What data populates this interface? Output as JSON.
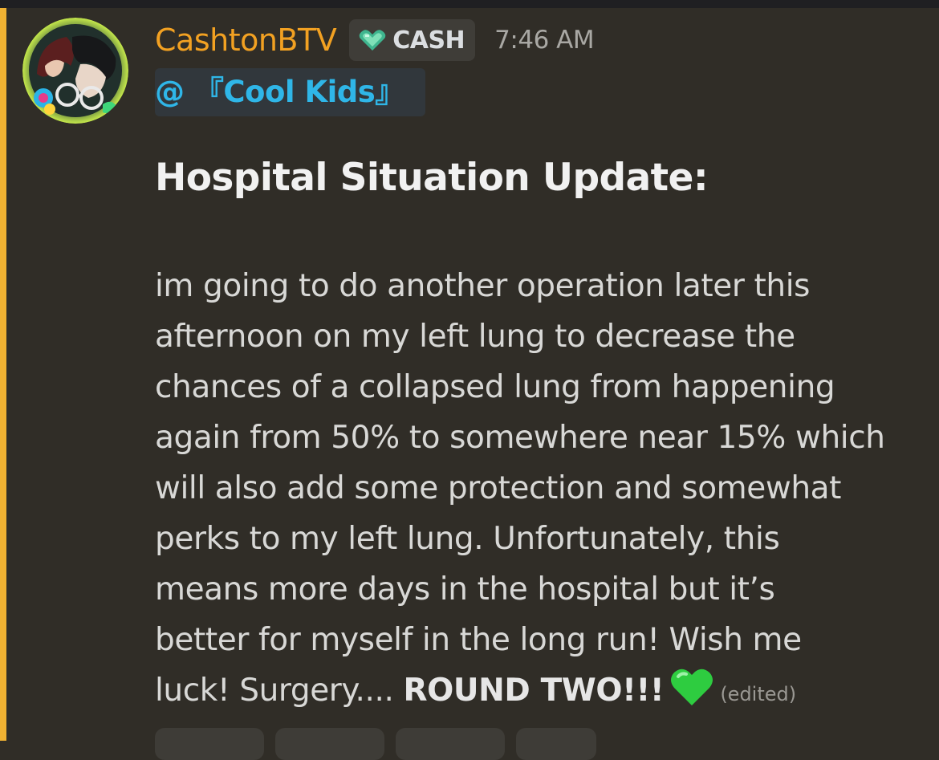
{
  "message": {
    "username": "CashtonBTV",
    "role_tag": {
      "icon": "heart-gem-icon",
      "label": "CASH",
      "icon_color": "#3fb58f"
    },
    "timestamp": "7:46 AM",
    "role_mention": "@ 『Cool Kids』",
    "heading": "Hospital Situation Update:",
    "body_lines": [
      "im going to do another operation later this",
      "afternoon on my left lung to decrease the",
      "chances of a collapsed lung from happening",
      "again from 50% to somewhere near 15% which",
      "will also add some protection and somewhat",
      "perks to my left lung. Unfortunately, this",
      "means more days in the hospital but it’s",
      "better for myself in the long run! Wish me"
    ],
    "last_line_prefix": "luck! Surgery.... ",
    "last_line_bold": "ROUND TWO!!!",
    "emoji": "green-heart-icon",
    "edited_label": "(edited)"
  },
  "colors": {
    "background": "#302d27",
    "mention_highlight_bar": "#f0b232",
    "username": "#f2a122",
    "role_mention_text": "#2fb6e8",
    "role_mention_bg": "#31373c",
    "heart": "#2ecc40"
  }
}
